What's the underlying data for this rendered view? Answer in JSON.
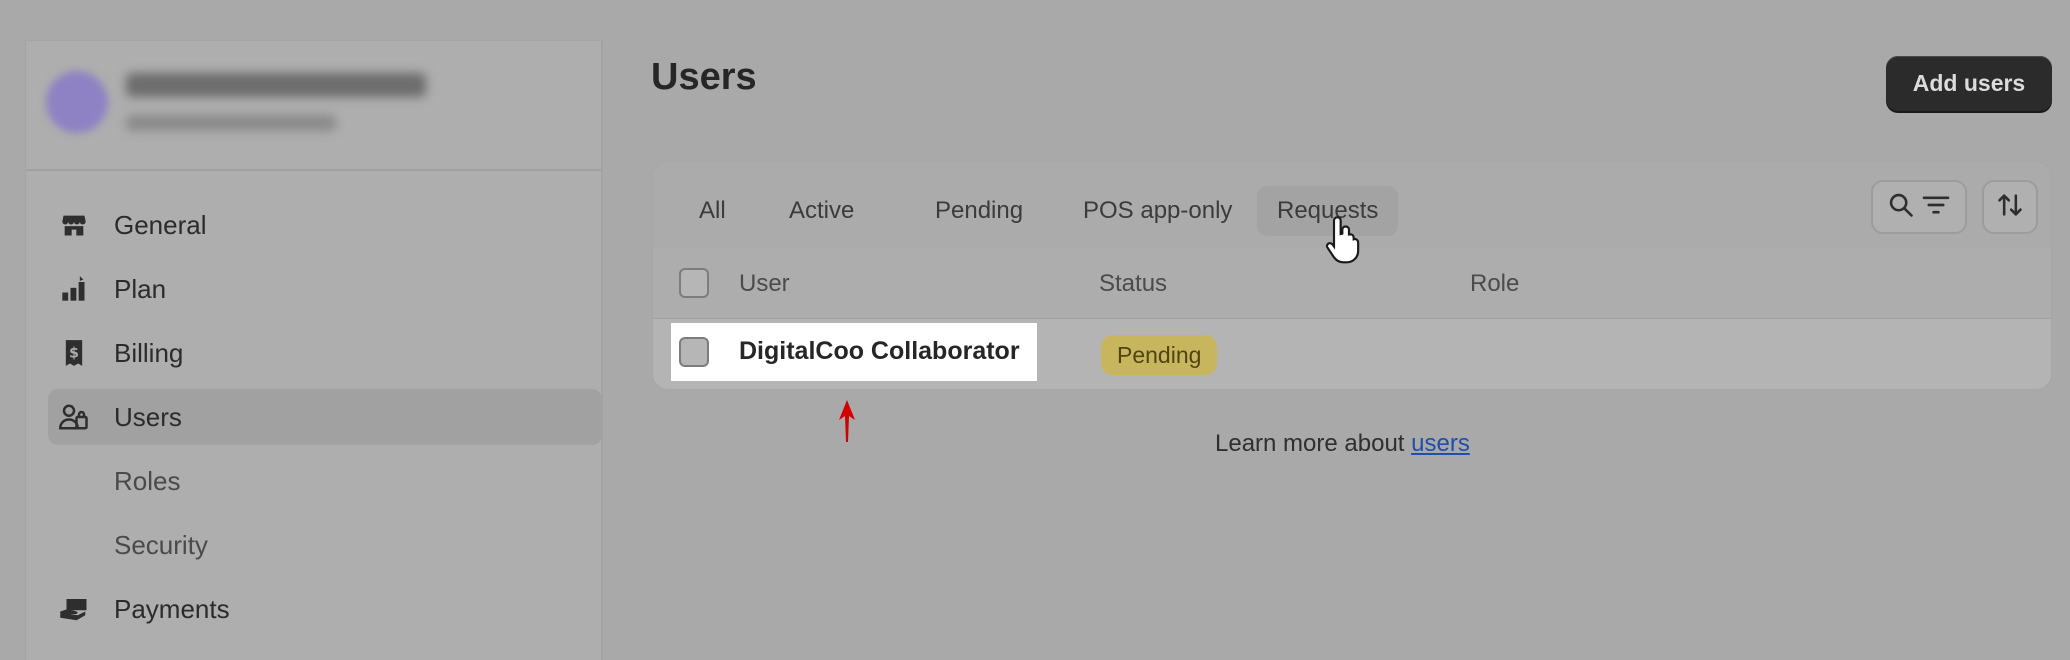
{
  "sidebar": {
    "items": [
      {
        "label": "General",
        "icon": "store-icon",
        "active": false,
        "sub": false
      },
      {
        "label": "Plan",
        "icon": "plan-chart-icon",
        "active": false,
        "sub": false
      },
      {
        "label": "Billing",
        "icon": "billing-receipt-icon",
        "active": false,
        "sub": false
      },
      {
        "label": "Users",
        "icon": "users-icon",
        "active": true,
        "sub": false
      },
      {
        "label": "Roles",
        "icon": "",
        "active": false,
        "sub": true
      },
      {
        "label": "Security",
        "icon": "",
        "active": false,
        "sub": true
      },
      {
        "label": "Payments",
        "icon": "payments-hand-icon",
        "active": false,
        "sub": false
      }
    ]
  },
  "header": {
    "title": "Users",
    "add_button_label": "Add users"
  },
  "tabs": [
    {
      "label": "All"
    },
    {
      "label": "Active"
    },
    {
      "label": "Pending"
    },
    {
      "label": "POS app-only"
    },
    {
      "label": "Requests"
    }
  ],
  "table": {
    "columns": [
      "User",
      "Status",
      "Role"
    ],
    "rows": [
      {
        "user": "DigitalCoo Collaborator",
        "status": "Pending",
        "role": ""
      }
    ]
  },
  "footer": {
    "text": "Learn more about ",
    "link": "users"
  },
  "colors": {
    "status_pending_bg": "#c8b65f",
    "link": "#1f4fa8",
    "primary_button": "#2b2b2b"
  }
}
